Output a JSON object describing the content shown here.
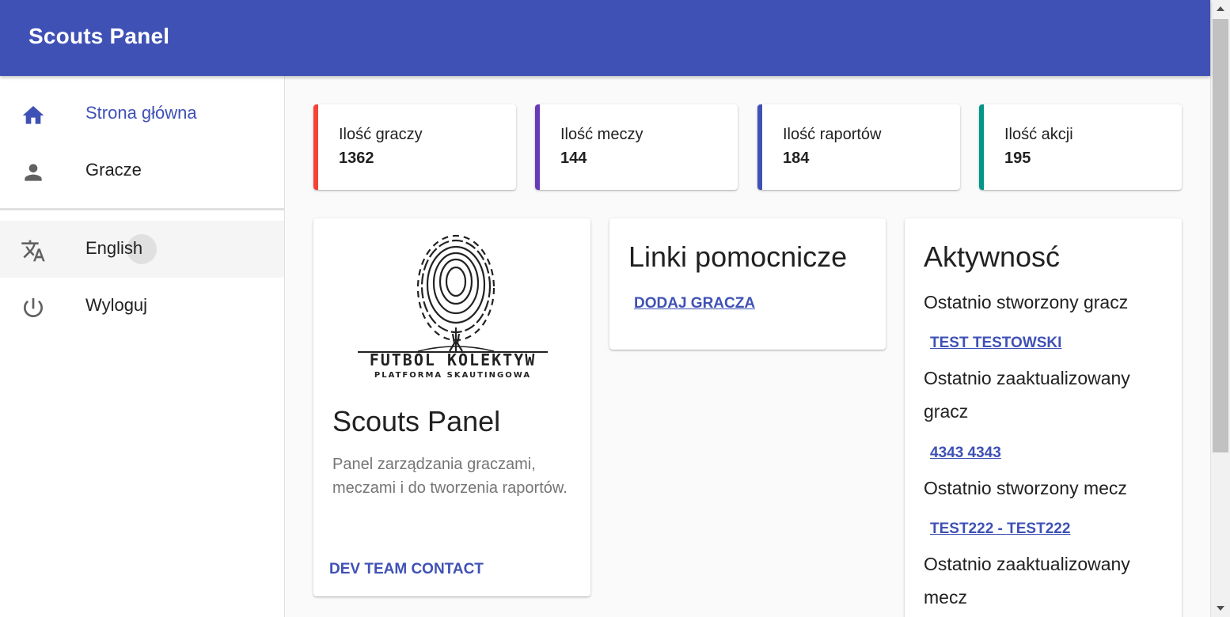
{
  "app": {
    "title": "Scouts Panel"
  },
  "nav": {
    "home": "Strona główna",
    "players": "Gracze",
    "language": "English",
    "logout": "Wyloguj"
  },
  "stats": [
    {
      "label": "Ilość graczy",
      "value": "1362",
      "color": "#f44336"
    },
    {
      "label": "Ilość meczy",
      "value": "144",
      "color": "#673ab7"
    },
    {
      "label": "Ilość raportów",
      "value": "184",
      "color": "#3f51b5"
    },
    {
      "label": "Ilość akcji",
      "value": "195",
      "color": "#009688"
    }
  ],
  "about": {
    "logo_text": "FUTBOL KOLEKTYW",
    "logo_subtext": "PLATFORMA SKAUTINGOWA",
    "title": "Scouts Panel",
    "description": "Panel zarządzania graczami, meczami i do tworzenia raportów.",
    "button": "DEV TEAM CONTACT"
  },
  "links": {
    "title": "Linki pomocnicze",
    "add_player": "DODAJ GRACZA"
  },
  "activity": {
    "title": "Aktywnosć",
    "last_created_player_label": "Ostatnio stworzony gracz",
    "last_created_player": "TEST TESTOWSKI",
    "last_updated_player_label_1": "Ostatnio zaaktualizowany",
    "last_updated_player_label_2": "gracz",
    "last_updated_player": "4343 4343",
    "last_created_match_label": "Ostatnio stworzony mecz",
    "last_created_match": "TEST222 - TEST222",
    "last_updated_match_label_1": "Ostatnio zaaktualizowany",
    "last_updated_match_label_2": "mecz"
  },
  "colors": {
    "primary": "#3f51b5"
  }
}
